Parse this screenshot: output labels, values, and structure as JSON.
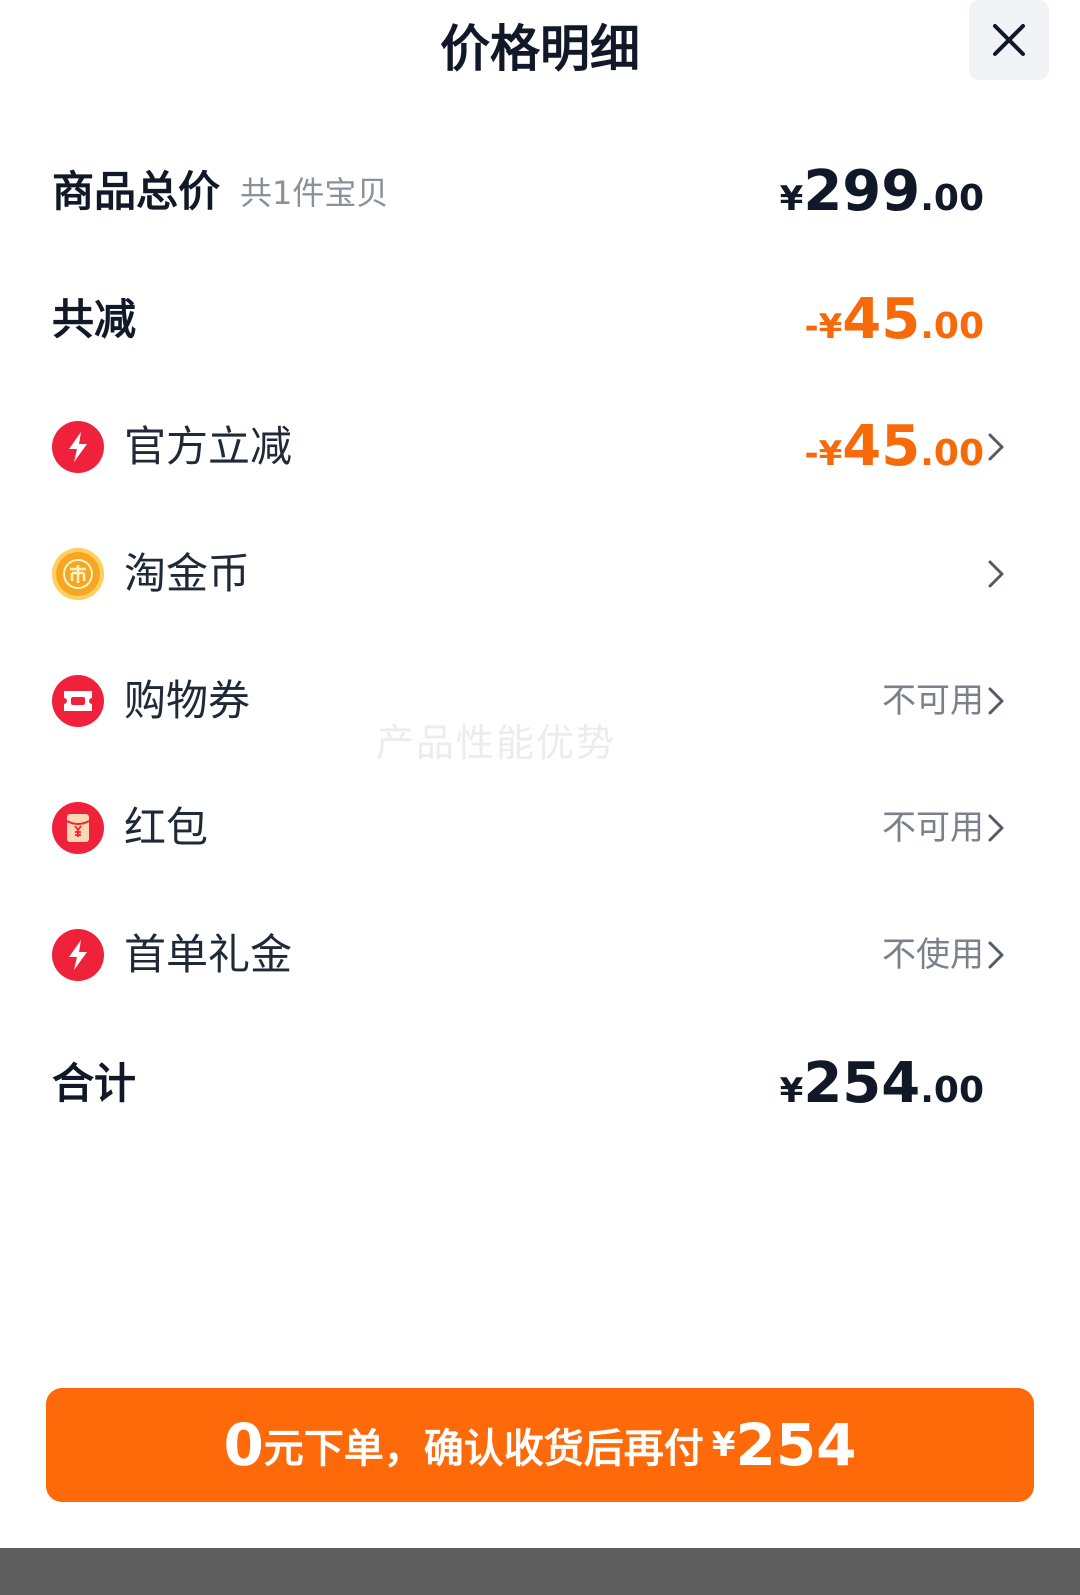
{
  "header": {
    "title": "价格明细",
    "close_icon": "close-icon"
  },
  "rows": {
    "subtotal": {
      "label": "商品总价",
      "note": "共1件宝贝",
      "currency": "¥",
      "int": "299",
      "dec": ".00"
    },
    "discount_total": {
      "label": "共减",
      "sign": "-",
      "currency": "¥",
      "int": "45",
      "dec": ".00"
    },
    "official": {
      "label": "官方立减",
      "icon": "lightning-icon",
      "sign": "-",
      "currency": "¥",
      "int": "45",
      "dec": ".00"
    },
    "coins": {
      "label": "淘金币",
      "icon": "coin-icon"
    },
    "coupon": {
      "label": "购物券",
      "icon": "ticket-icon",
      "status": "不可用"
    },
    "redpacket": {
      "label": "红包",
      "icon": "red-packet-icon",
      "status": "不可用"
    },
    "first_order": {
      "label": "首单礼金",
      "icon": "lightning-icon",
      "status": "不使用"
    },
    "total": {
      "label": "合计",
      "currency": "¥",
      "int": "254",
      "dec": ".00"
    }
  },
  "watermark": "产品性能优势",
  "cta": {
    "big": "0",
    "text": "元下单，确认收货后再付",
    "currency": "¥",
    "amount": "254"
  },
  "colors": {
    "accent": "#fe6a0a",
    "discount": "#f76a0a",
    "icon_red": "#f0213b",
    "coin": "#f5a623"
  }
}
